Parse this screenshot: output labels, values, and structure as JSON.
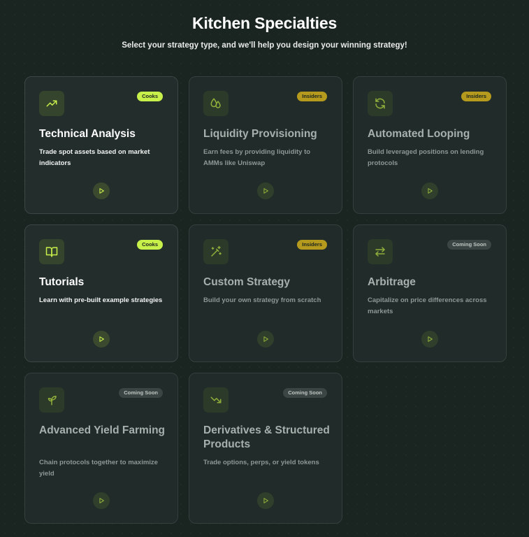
{
  "header": {
    "title": "Kitchen Specialties",
    "subtitle": "Select your strategy type, and we'll help you design your winning strategy!"
  },
  "colors": {
    "accent": "#c8f04b",
    "insiders": "#b59a1d",
    "coming_soon": "#3b4543",
    "background": "#1a2421",
    "card": "#222d2c"
  },
  "cards": [
    {
      "title": "Technical Analysis",
      "description": "Trade spot assets based on market indicators",
      "badge": "Cooks",
      "icon": "trending-up-icon"
    },
    {
      "title": "Liquidity Provisioning",
      "description": "Earn fees by providing liquidity to AMMs like Uniswap",
      "badge": "Insiders",
      "icon": "droplets-icon"
    },
    {
      "title": "Automated Looping",
      "description": "Build leveraged positions on lending protocols",
      "badge": "Insiders",
      "icon": "refresh-icon"
    },
    {
      "title": "Tutorials",
      "description": "Learn with pre-built example strategies",
      "badge": "Cooks",
      "icon": "book-open-icon"
    },
    {
      "title": "Custom Strategy",
      "description": "Build your own strategy from scratch",
      "badge": "Insiders",
      "icon": "magic-wand-icon"
    },
    {
      "title": "Arbitrage",
      "description": "Capitalize on price differences across markets",
      "badge": "Coming Soon",
      "icon": "arrows-left-right-icon"
    },
    {
      "title": "Advanced Yield Farming",
      "description": "Chain protocols together to maximize yield",
      "badge": "Coming Soon",
      "icon": "sprout-icon"
    },
    {
      "title": "Derivatives & Structured Products",
      "description": "Trade options, perps, or yield tokens",
      "badge": "Coming Soon",
      "icon": "trending-down-icon"
    }
  ]
}
